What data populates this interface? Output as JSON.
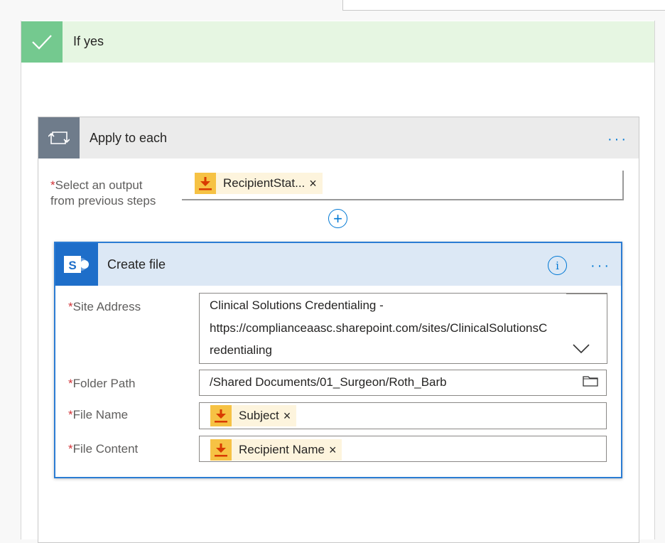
{
  "condition": {
    "label": "If yes"
  },
  "apply_to_each": {
    "title": "Apply to each",
    "more_label": "···",
    "select_output": {
      "label_line1": "Select an output",
      "label_line2": "from previous steps",
      "token": "RecipientStat...",
      "token_remove": "×"
    },
    "add_label": "+"
  },
  "create_file": {
    "title": "Create file",
    "info_label": "i",
    "more_label": "···",
    "fields": {
      "site_address": {
        "label": "Site Address",
        "line1": "Clinical Solutions Credentialing -",
        "line2": "https://complianceaasc.sharepoint.com/sites/ClinicalSolutionsC",
        "line3": "redentialing"
      },
      "folder_path": {
        "label": "Folder Path",
        "value": "/Shared Documents/01_Surgeon/Roth_Barb"
      },
      "file_name": {
        "label": "File Name",
        "token": "Subject",
        "token_remove": "×"
      },
      "file_content": {
        "label": "File Content",
        "token": "Recipient Name",
        "token_remove": "×"
      }
    }
  },
  "required_mark": "*",
  "colors": {
    "yes_header": "#e6f6e2",
    "yes_icon": "#74c98f",
    "loop_icon": "#6f7c8b",
    "sharepoint_icon": "#1e6ec9",
    "accent": "#0078d4",
    "token_icon": "#f6c244",
    "required": "#d13438"
  },
  "icons": {
    "condition": "checkmark-icon",
    "loop": "loop-icon",
    "sharepoint": "sharepoint-icon",
    "token": "download-icon",
    "folder": "folder-icon",
    "dropdown": "chevron-down-icon"
  }
}
